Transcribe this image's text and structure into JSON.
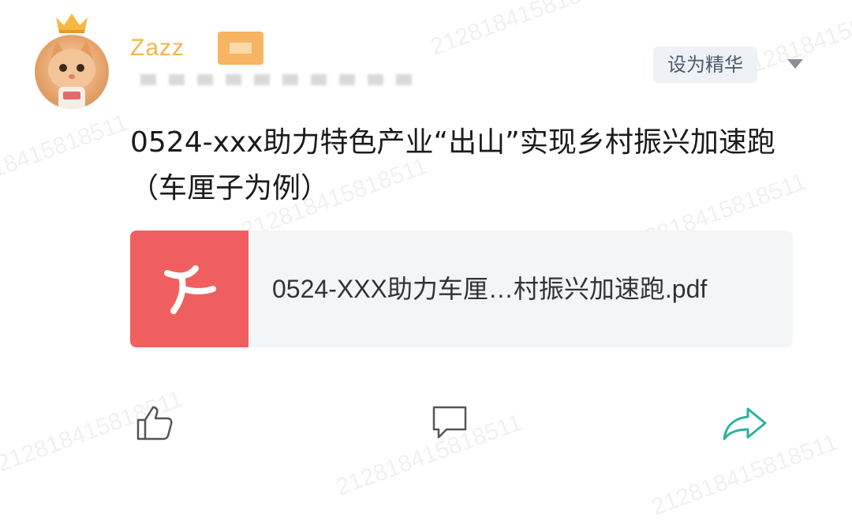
{
  "post": {
    "author": "Zazz",
    "feature_button": "设为精华",
    "title": "0524-xxx助力特色产业“出山”实现乡村振兴加速跑（车厘子为例）",
    "attachment": {
      "file_name": "0524-XXX助力车厘…村振兴加速跑.pdf",
      "type_icon": "pdf-icon",
      "accent_color": "#f05f5f"
    }
  },
  "actions": {
    "like_icon": "thumbs-up-icon",
    "comment_icon": "comment-icon",
    "share_icon": "share-icon",
    "share_color": "#2bb39b"
  },
  "watermark": "212818415818511"
}
